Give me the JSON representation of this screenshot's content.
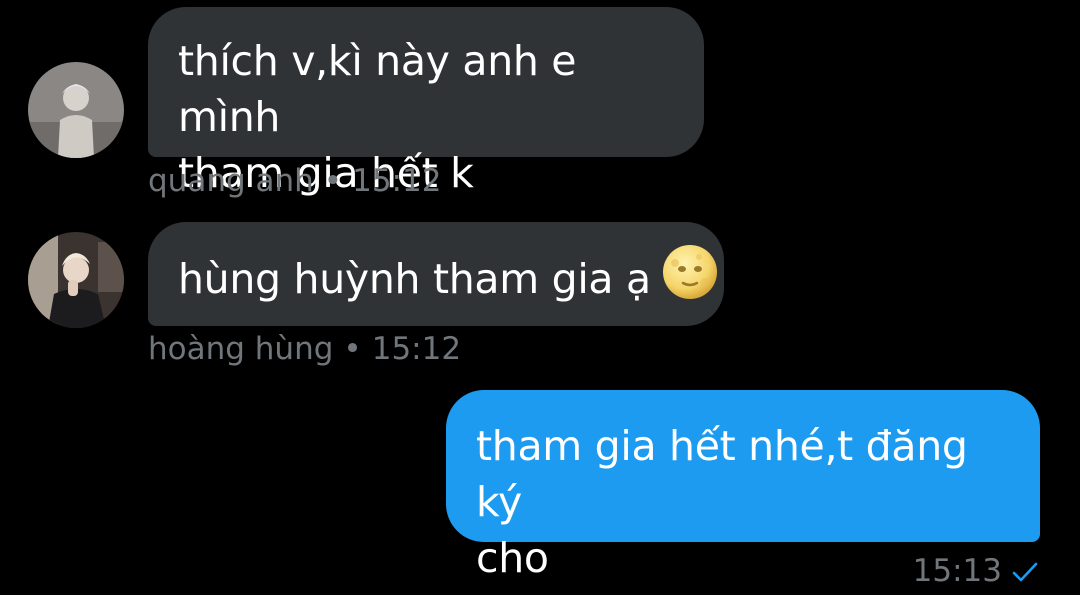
{
  "messages": [
    {
      "sender": "quang anh",
      "direction": "incoming",
      "line1": "thích v,kì này anh e mình",
      "line2": "tham gia hết k",
      "time": "15:12"
    },
    {
      "sender": "hoàng hùng",
      "direction": "incoming",
      "text": "hùng huỳnh tham gia ạ",
      "emoji": "full-moon-face-icon",
      "time": "15:12"
    },
    {
      "direction": "outgoing",
      "line1": "tham gia hết nhé,t đăng ký",
      "line2": "cho",
      "time": "15:13",
      "status_icon": "sent-check-icon"
    }
  ],
  "separator": "•",
  "colors": {
    "background": "#000000",
    "incoming_bubble": "#2f3336",
    "outgoing_bubble": "#1d9bf0",
    "meta_text": "#71767b",
    "check": "#1d9bf0"
  }
}
